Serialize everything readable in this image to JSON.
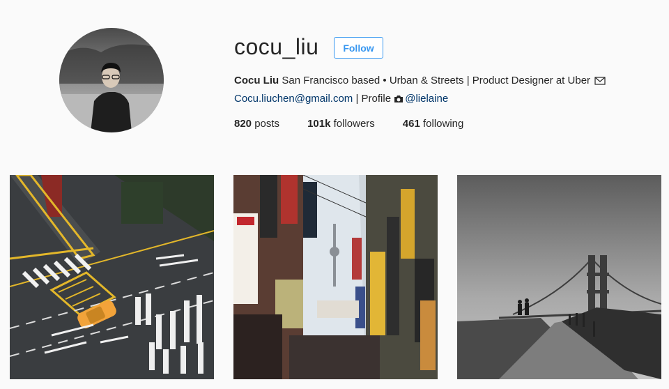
{
  "profile": {
    "username": "cocu_liu",
    "follow_label": "Follow",
    "display_name": "Cocu Liu",
    "bio_text": "San Francisco based • Urban & Streets | Product Designer at Uber",
    "email": "Cocu.liuchen@gmail.com",
    "separator": " | ",
    "profile_label": "Profile",
    "handle": "@lielaine"
  },
  "stats": {
    "posts_count": "820",
    "posts_label": "posts",
    "followers_count": "101k",
    "followers_label": "followers",
    "following_count": "461",
    "following_label": "following"
  },
  "icons": {
    "email": "envelope-icon",
    "profile": "camera-icon"
  },
  "colors": {
    "accent": "#3897f0",
    "background": "#fafafa",
    "text": "#262626"
  },
  "posts": [
    {
      "icon": "street-intersection-photo"
    },
    {
      "icon": "seoul-street-signs-photo"
    },
    {
      "icon": "golden-gate-bridge-photo"
    }
  ]
}
